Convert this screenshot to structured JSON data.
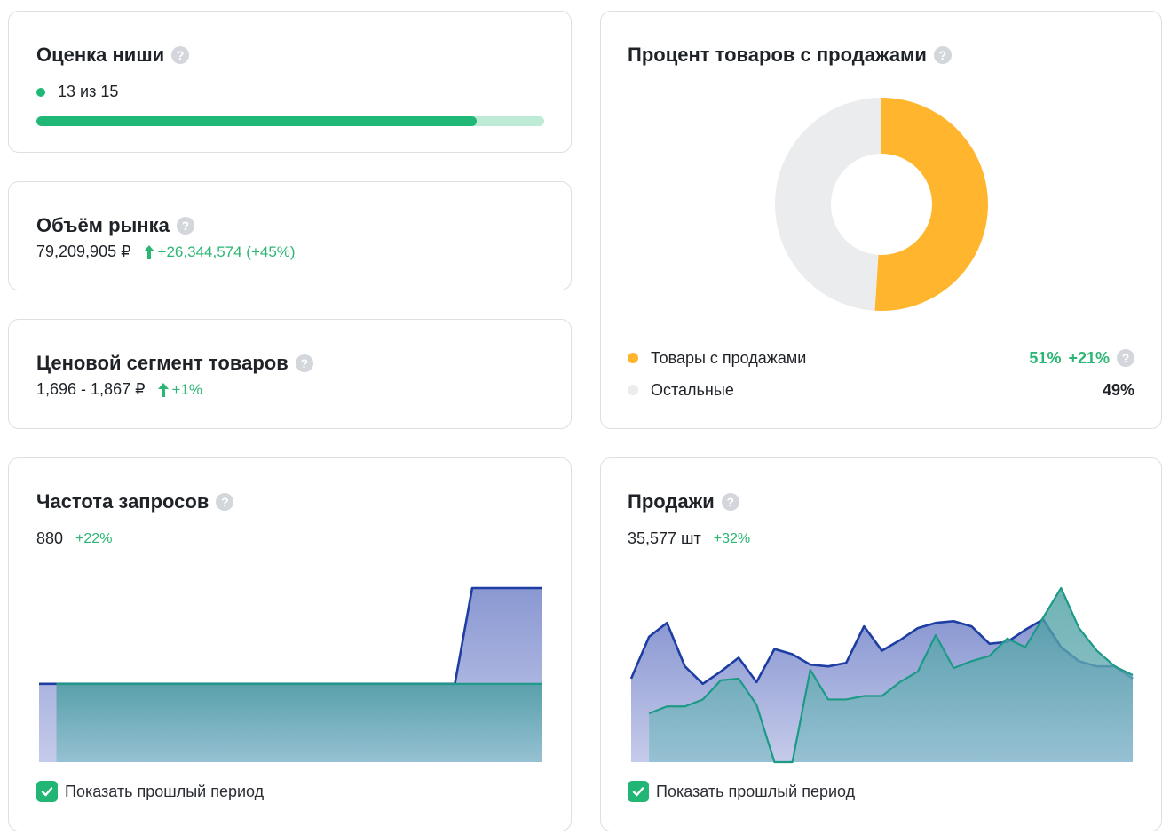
{
  "niche": {
    "title": "Оценка ниши",
    "score_text": "13 из 15",
    "score": 13,
    "max": 15,
    "color": "#20b877"
  },
  "market": {
    "title": "Объём рынка",
    "value": "79,209,905 ₽",
    "delta": "+26,344,574 (+45%)"
  },
  "price": {
    "title": "Ценовой сегмент товаров",
    "value": "1,696 - 1,867 ₽",
    "delta": "+1%"
  },
  "sales_share": {
    "title": "Процент товаров с продажами",
    "legend": [
      {
        "label": "Товары с продажами",
        "percent": "51%",
        "change": "+21%",
        "color": "#ffb52e"
      },
      {
        "label": "Остальные",
        "percent": "49%",
        "color": "#ebecee"
      }
    ],
    "chart_data": {
      "type": "pie",
      "variant": "donut",
      "slices": [
        {
          "label": "Товары с продажами",
          "value": 51,
          "color": "#ffb52e"
        },
        {
          "label": "Остальные",
          "value": 49,
          "color": "#ebecee"
        }
      ]
    }
  },
  "queries": {
    "title": "Частота запросов",
    "value": "880",
    "delta": "+22%",
    "checkbox_label": "Показать прошлый период",
    "chart_data": {
      "type": "area",
      "ylim": [
        0,
        1
      ],
      "series": [
        {
          "role": "current",
          "color": "#1f3ea3",
          "values": [
            0.45,
            0.45,
            0.45,
            0.45,
            0.45,
            0.45,
            0.45,
            0.45,
            0.45,
            0.45,
            0.45,
            0.45,
            0.45,
            0.45,
            0.45,
            0.45,
            0.45,
            0.45,
            0.45,
            0.45,
            0.45,
            0.45,
            0.45,
            0.45,
            0.45,
            1.0,
            1.0,
            1.0,
            1.0,
            1.0
          ]
        },
        {
          "role": "previous",
          "color": "#1d9a86",
          "values": [
            null,
            0.45,
            0.45,
            0.45,
            0.45,
            0.45,
            0.45,
            0.45,
            0.45,
            0.45,
            0.45,
            0.45,
            0.45,
            0.45,
            0.45,
            0.45,
            0.45,
            0.45,
            0.45,
            0.45,
            0.45,
            0.45,
            0.45,
            0.45,
            0.45,
            0.45,
            0.45,
            0.45,
            0.45,
            0.45
          ]
        }
      ]
    }
  },
  "sales": {
    "title": "Продажи",
    "value": "35,577 шт",
    "delta": "+32%",
    "checkbox_label": "Показать прошлый период",
    "chart_data": {
      "type": "area",
      "ylim": [
        0,
        1
      ],
      "series": [
        {
          "role": "current",
          "color": "#1f3ea3",
          "values": [
            0.48,
            0.72,
            0.8,
            0.55,
            0.45,
            0.52,
            0.6,
            0.46,
            0.65,
            0.62,
            0.56,
            0.55,
            0.57,
            0.78,
            0.64,
            0.7,
            0.77,
            0.8,
            0.81,
            0.78,
            0.68,
            0.69,
            0.76,
            0.82,
            0.66,
            0.58,
            0.55,
            0.55,
            0.48
          ]
        },
        {
          "role": "previous",
          "color": "#1d9a86",
          "values": [
            null,
            0.28,
            0.32,
            0.32,
            0.36,
            0.47,
            0.48,
            0.33,
            0.0,
            0.0,
            0.53,
            0.36,
            0.36,
            0.38,
            0.38,
            0.46,
            0.52,
            0.73,
            0.54,
            0.58,
            0.61,
            0.71,
            0.66,
            0.83,
            1.0,
            0.77,
            0.64,
            0.55,
            0.5
          ]
        }
      ]
    }
  }
}
